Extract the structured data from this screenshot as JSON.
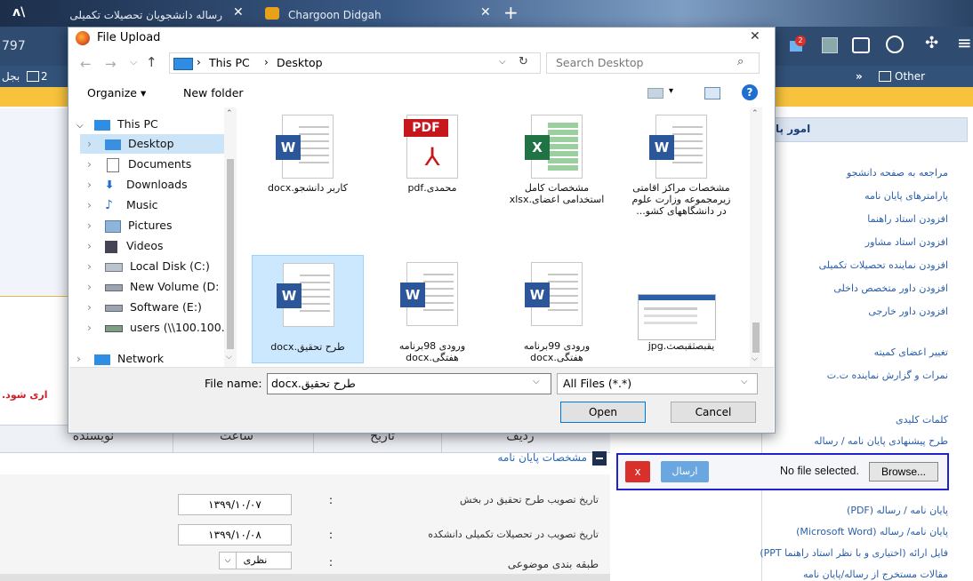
{
  "browser": {
    "tabs": [
      {
        "label": "رساله دانشجویان تحصیلات تکمیلی"
      },
      {
        "label": "Chargoon Didgah"
      }
    ],
    "left_number": "797",
    "other_bookmarks": "Other Bookmarks",
    "bookmark_left": "2",
    "bookmark_left2": "بجل"
  },
  "dialog": {
    "title": "File Upload",
    "breadcrumb": [
      "This PC",
      "Desktop"
    ],
    "search_placeholder": "Search Desktop",
    "organize": "Organize ▾",
    "new_folder": "New folder",
    "nav_items": [
      {
        "label": "This PC"
      },
      {
        "label": "Desktop"
      },
      {
        "label": "Documents"
      },
      {
        "label": "Downloads"
      },
      {
        "label": "Music"
      },
      {
        "label": "Pictures"
      },
      {
        "label": "Videos"
      },
      {
        "label": "Local Disk (C:)"
      },
      {
        "label": "New Volume (D:"
      },
      {
        "label": "Software (E:)"
      },
      {
        "label": "users (\\\\100.100."
      },
      {
        "label": "Network"
      }
    ],
    "files": [
      {
        "name": "کاربر دانشجو.docx",
        "type": "word"
      },
      {
        "name": "محمدی.pdf",
        "type": "pdf"
      },
      {
        "name": "مشخصات کامل استخدامی اعضای.xlsx",
        "type": "excel"
      },
      {
        "name": "مشخصات مراکز اقامتی زیرمجموعه وزارت علوم در دانشگاههای کشو...",
        "type": "word"
      },
      {
        "name": "طرح تحقیق.docx",
        "type": "word"
      },
      {
        "name": "ورودی 98برنامه هفتگی.docx",
        "type": "word"
      },
      {
        "name": "ورودی 99برنامه هفتگی.docx",
        "type": "word"
      },
      {
        "name": "یقبصثقبصث.jpg",
        "type": "image"
      }
    ],
    "file_name_label": "File name:",
    "file_name_value": "طرح تحقیق.docx",
    "file_type": "All Files (*.*)",
    "open": "Open",
    "cancel": "Cancel"
  },
  "page": {
    "warning_fragment": "اری شود.",
    "table_headers": [
      "نویسنده",
      "ساعت",
      "تاریخ",
      "ردیف"
    ],
    "section_title": "مشخصات پایان نامه",
    "fields": [
      {
        "label": "تاریخ تصویب طرح تحقیق در بخش",
        "value": "۱۳۹۹/۱۰/۰۷"
      },
      {
        "label": "تاریخ تصویب در تحصیلات تکمیلی دانشکده",
        "value": "۱۳۹۹/۱۰/۰۸"
      },
      {
        "label": "طبقه بندی موضوعی",
        "value": "نظری"
      }
    ],
    "sidebar_header": "امور پایا",
    "sidebar_links": [
      "مراجعه به صفحه دانشجو",
      "پارامترهای پایان نامه",
      "افزودن استاد راهنما",
      "افزودن استاد مشاور",
      "افزودن نماینده تحصیلات تکمیلی",
      "افزودن داور متخصص داخلی",
      "افزودن داور خارجی"
    ],
    "sidebar_links2": [
      "تغییر اعضای کمیته",
      "نمرات و گزارش نماینده ت.ت"
    ],
    "sidebar_links3": [
      "کلمات کلیدی",
      "طرح پیشنهادی پایان نامه / رساله"
    ],
    "upload": {
      "delete": "x",
      "send": "ارسال",
      "no_file": "No file selected.",
      "browse": "Browse..."
    },
    "sidebar_links4": [
      "پایان نامه / رساله (PDF)",
      "پایان نامه/ رساله (Microsoft Word)",
      "فایل ارائه (اختیاری و با نظر استاد راهنما PPT)",
      "مقالات مستخرج از رساله/پایان نامه"
    ]
  }
}
